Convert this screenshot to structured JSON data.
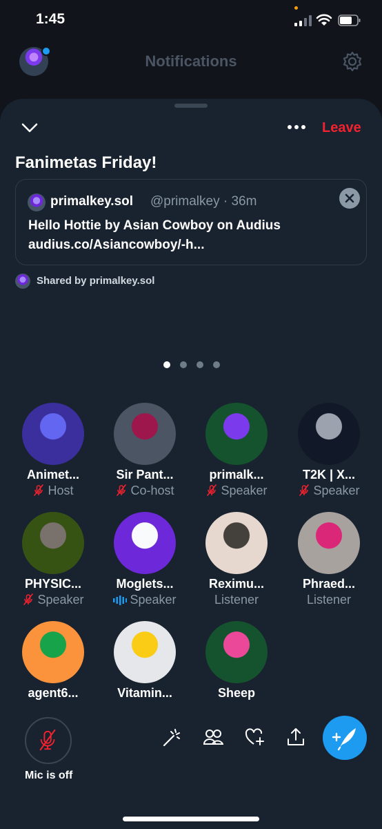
{
  "status_bar": {
    "time": "1:45"
  },
  "background": {
    "title": "Notifications"
  },
  "space": {
    "title": "Fanimetas Friday!",
    "leave_label": "Leave",
    "pinned_tweet": {
      "author_name": "primalkey.sol",
      "author_handle_time": "@primalkey · 36m",
      "text_line1": "Hello Hottie by Asian Cowboy  on Audius",
      "text_line2": "audius.co/Asiancowboy/-h..."
    },
    "shared_by": "Shared by primalkey.sol",
    "pager": {
      "pages": 4,
      "active": 1
    }
  },
  "participants": [
    {
      "name": "Animet...",
      "role": "Host",
      "mic": "muted",
      "colors": [
        "#3b2f9e",
        "#6366f1"
      ]
    },
    {
      "name": "Sir Pant...",
      "role": "Co-host",
      "mic": "muted",
      "colors": [
        "#4b5563",
        "#9d174d"
      ]
    },
    {
      "name": "primalk...",
      "role": "Speaker",
      "mic": "muted",
      "colors": [
        "#14532d",
        "#7c3aed"
      ]
    },
    {
      "name": "T2K | X...",
      "role": "Speaker",
      "mic": "muted",
      "colors": [
        "#111827",
        "#9ca3af"
      ]
    },
    {
      "name": "PHYSIC...",
      "role": "Speaker",
      "mic": "muted",
      "colors": [
        "#365314",
        "#78716c"
      ]
    },
    {
      "name": "Moglets...",
      "role": "Speaker",
      "mic": "speaking",
      "colors": [
        "#6d28d9",
        "#f8fafc"
      ]
    },
    {
      "name": "Reximu...",
      "role": "Listener",
      "mic": "none",
      "colors": [
        "#e7d8cf",
        "#44403c"
      ]
    },
    {
      "name": "Phraed...",
      "role": "Listener",
      "mic": "none",
      "colors": [
        "#a8a29e",
        "#db2777"
      ]
    },
    {
      "name": "agent6...",
      "role": "",
      "mic": "none",
      "colors": [
        "#fb923c",
        "#16a34a"
      ]
    },
    {
      "name": "Vitamin...",
      "role": "",
      "mic": "none",
      "colors": [
        "#e5e7eb",
        "#facc15"
      ]
    },
    {
      "name": "Sheep",
      "role": "",
      "mic": "none",
      "colors": [
        "#14532d",
        "#ec4899"
      ]
    }
  ],
  "bottom": {
    "mic_label": "Mic is off"
  },
  "icons": [
    "chevron-down-icon",
    "more-icon",
    "close-icon",
    "mic-off-icon",
    "sparkle-icon",
    "people-icon",
    "heart-plus-icon",
    "share-icon",
    "compose-icon"
  ],
  "colors": {
    "accent": "#1d9bf0",
    "leave": "#f4212e",
    "sheet": "#192330"
  }
}
